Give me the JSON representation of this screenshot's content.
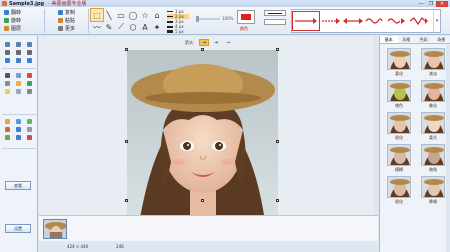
{
  "window": {
    "file_name": "Sample3.jpg",
    "app_title": "- 美图画图专业版",
    "controls": [
      "—",
      "❐",
      "✕"
    ]
  },
  "ribbon": {
    "clipboard": [
      {
        "label": "翻转",
        "icon": "flip-icon",
        "color": "#3f7fd0"
      },
      {
        "label": "旋转",
        "icon": "rotate-icon",
        "color": "#45a04a"
      },
      {
        "label": "图层",
        "icon": "layers-icon",
        "color": "#d08a2a"
      }
    ],
    "edit": [
      {
        "label": "复制",
        "icon": "copy-icon",
        "color": "#3f7fd0"
      },
      {
        "label": "粘贴",
        "icon": "paste-icon",
        "color": "#c58a2e"
      },
      {
        "label": "更多",
        "icon": "more-icon",
        "color": "#7a7a7a"
      }
    ],
    "shape_tools": [
      {
        "glyph": "⬚",
        "name": "select-tool-icon"
      },
      {
        "glyph": "╲",
        "name": "line-tool-icon"
      },
      {
        "glyph": "▭",
        "name": "rectangle-tool-icon"
      },
      {
        "glyph": "◯",
        "name": "ellipse-tool-icon"
      },
      {
        "glyph": "☆",
        "name": "star-tool-icon"
      },
      {
        "glyph": "⌂",
        "name": "shape-tool-icon"
      },
      {
        "glyph": "〰",
        "name": "curve-tool-icon"
      },
      {
        "glyph": "✎",
        "name": "pencil-tool-icon"
      },
      {
        "glyph": "⟋",
        "name": "brush-tool-icon"
      },
      {
        "glyph": "⬡",
        "name": "polygon-tool-icon"
      },
      {
        "glyph": "A",
        "name": "text-tool-icon"
      },
      {
        "glyph": "✦",
        "name": "sparkle-tool-icon"
      }
    ],
    "sizes": [
      {
        "label": "1 px"
      },
      {
        "label": "2 px"
      },
      {
        "label": "3 px"
      },
      {
        "label": "4 px"
      },
      {
        "label": "5 px"
      }
    ],
    "opacity_value": "100%",
    "color_label": "颜色",
    "arrow_more": "▾"
  },
  "left_panel": {
    "view_button": "查看",
    "settings_button": "设置"
  },
  "workspace": {
    "toolbar_label": "箭头:",
    "toolbar_buttons": [
      "➜",
      "➔",
      "➙"
    ]
  },
  "right_panel": {
    "tabs": [
      {
        "label": "基本"
      },
      {
        "label": "风格"
      },
      {
        "label": "色彩"
      },
      {
        "label": "场景"
      }
    ],
    "effects": [
      {
        "label": "柔化"
      },
      {
        "label": "减淡"
      },
      {
        "label": "增色"
      },
      {
        "label": "美化"
      },
      {
        "label": "锐化"
      },
      {
        "label": "柔光"
      },
      {
        "label": "模糊"
      },
      {
        "label": "暗角"
      },
      {
        "label": "锐化"
      },
      {
        "label": "降噪"
      }
    ]
  },
  "status": {
    "dimensions": "424 × 440",
    "info": "246"
  }
}
